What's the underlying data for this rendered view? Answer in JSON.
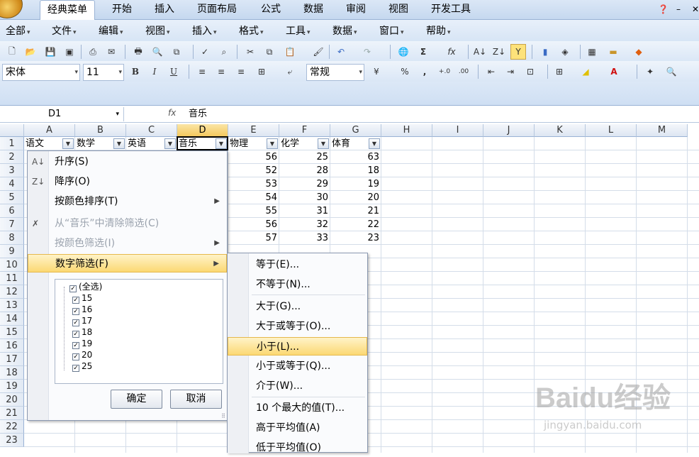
{
  "ribbon_tabs": [
    "经典菜单",
    "开始",
    "插入",
    "页面布局",
    "公式",
    "数据",
    "审阅",
    "视图",
    "开发工具"
  ],
  "active_tab": "经典菜单",
  "menus": [
    "全部",
    "文件",
    "编辑",
    "视图",
    "插入",
    "格式",
    "工具",
    "数据",
    "窗口",
    "帮助"
  ],
  "toolbar": {
    "font": "宋体",
    "size": "11",
    "number_format": "常规",
    "bold": "B",
    "italic": "I",
    "underline": "U"
  },
  "formula_bar": {
    "name_box": "D1",
    "fx": "fx",
    "content": "音乐"
  },
  "columns": [
    "A",
    "B",
    "C",
    "D",
    "E",
    "F",
    "G",
    "H",
    "I",
    "J",
    "K",
    "L",
    "M"
  ],
  "selected_column": "D",
  "rows": [
    "1",
    "2",
    "3",
    "4",
    "5",
    "6",
    "7",
    "8",
    "9",
    "10",
    "11",
    "12",
    "13",
    "14",
    "15",
    "16",
    "17",
    "18",
    "19",
    "20",
    "21",
    "22",
    "23"
  ],
  "headers": [
    "语文",
    "数学",
    "英语",
    "音乐",
    "物理",
    "化学",
    "体育"
  ],
  "data": {
    "E": [
      "56",
      "52",
      "53",
      "54",
      "55",
      "56",
      "57"
    ],
    "F": [
      "25",
      "28",
      "29",
      "30",
      "31",
      "32",
      "33"
    ],
    "G": [
      "63",
      "18",
      "19",
      "20",
      "21",
      "22",
      "23"
    ]
  },
  "dropdown": {
    "sort_asc": "升序(S)",
    "sort_desc": "降序(O)",
    "sort_color": "按颜色排序(T)",
    "clear_filter": "从“音乐”中清除筛选(C)",
    "filter_color": "按颜色筛选(I)",
    "number_filter": "数字筛选(F)",
    "checklist": [
      "(全选)",
      "15",
      "16",
      "17",
      "18",
      "19",
      "20",
      "25"
    ],
    "ok": "确定",
    "cancel": "取消"
  },
  "submenu": [
    "等于(E)...",
    "不等于(N)...",
    "大于(G)...",
    "大于或等于(O)...",
    "小于(L)...",
    "小于或等于(Q)...",
    "介于(W)...",
    "10 个最大的值(T)...",
    "高于平均值(A)",
    "低于平均值(O)"
  ],
  "submenu_highlight": "小于(L)...",
  "watermark": {
    "logo": "Baidu经验",
    "url": "jingyan.baidu.com"
  }
}
